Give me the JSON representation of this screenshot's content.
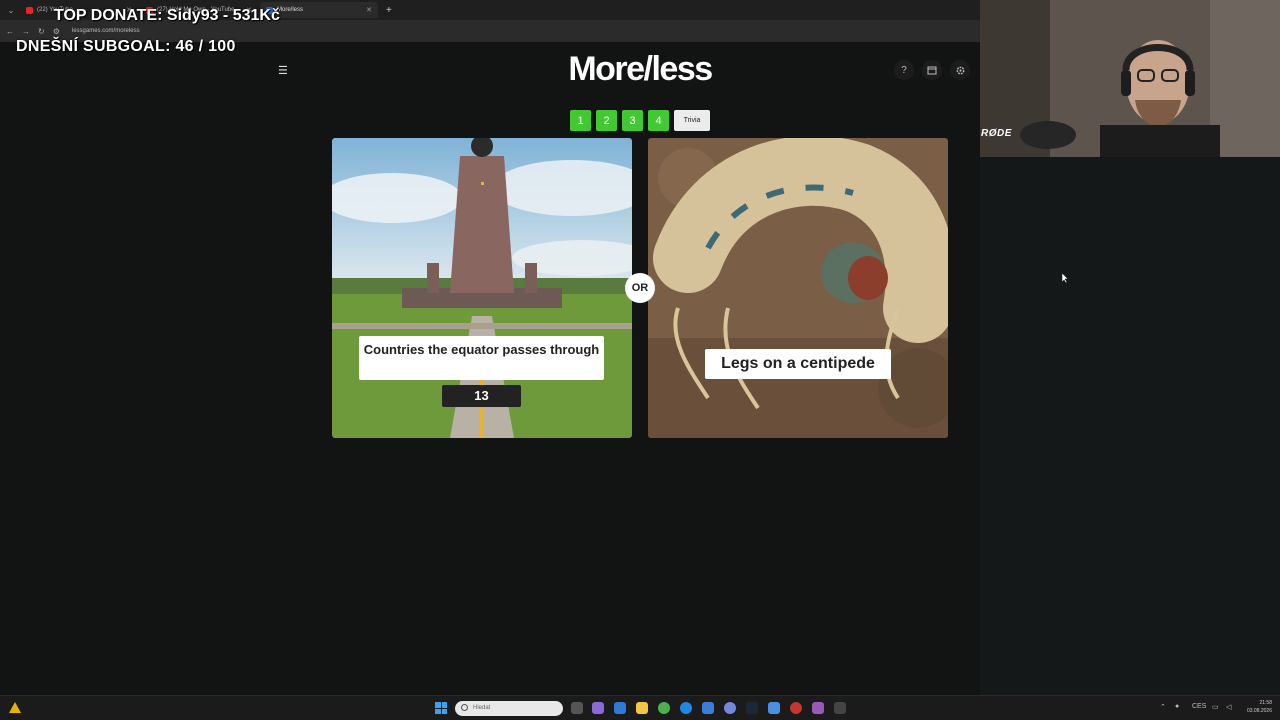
{
  "browser": {
    "tabs": [
      {
        "label": "(22) YouTube",
        "active": false
      },
      {
        "label": "(27) Hold Me Own - YouTube",
        "active": false
      },
      {
        "label": "More/less",
        "active": true
      }
    ],
    "url": "lessgames.com/moreless"
  },
  "stream_overlay": {
    "top_donate": "TOP DONATE: Sidy93 - 531Kč",
    "subgoal": "DNEŠNÍ SUBGOAL:  46 / 100"
  },
  "page": {
    "title": "More/less",
    "header_icons": [
      "help-icon",
      "calendar-icon",
      "settings-icon"
    ],
    "help_glyph": "?"
  },
  "levels": {
    "items": [
      "1",
      "2",
      "3",
      "4",
      "Trivia"
    ],
    "colors": {
      "level": "#42c832",
      "trivia": "#ececec"
    }
  },
  "cards": {
    "left": {
      "label": "Countries the equator passes through",
      "value": "13"
    },
    "right": {
      "label": "Legs on a centipede"
    },
    "separator": "OR"
  },
  "webcam": {
    "mic_brand": "RØDE"
  },
  "taskbar": {
    "search_placeholder": "Hledat",
    "language": "CES",
    "time": "21:58",
    "date": "03.08.2026"
  }
}
